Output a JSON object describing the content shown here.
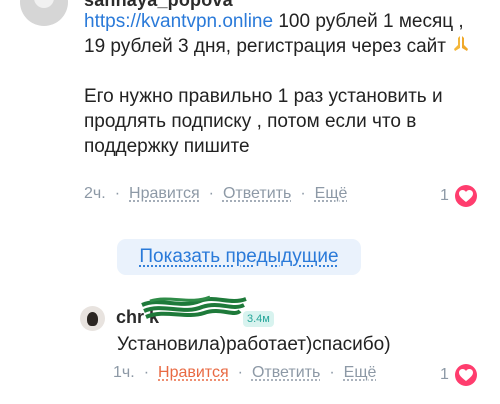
{
  "comment1": {
    "username": "sannaya_popova",
    "link": "https://kvantvpn.online",
    "text_after_link": " 100 рублей 1 месяц , 19 рублей 3 дня, регистрация через сайт ",
    "emoji": "praying-hands-emoji",
    "paragraph2": "Его нужно правильно 1 раз установить и продлять подписку , потом если что в поддержку пишите",
    "time": "2ч.",
    "like_label": "Нравится",
    "reply_label": "Ответить",
    "more_label": "Ещё",
    "like_count": "1"
  },
  "show_previous": "Показать предыдущие",
  "reply1": {
    "username": "chr     k",
    "badge": "3.4м",
    "text": "Установила)работает)спасибо)",
    "time": "1ч.",
    "like_label": "Нравится",
    "reply_label": "Ответить",
    "more_label": "Ещё",
    "like_count": "1",
    "liked": true
  },
  "colors": {
    "link": "#2a7ad9",
    "muted": "#8d99a6",
    "liked": "#e96a43",
    "heart": "#ff3d6e",
    "show_prev_bg": "#eaf2fc",
    "scribble": "#1e7a3a"
  }
}
